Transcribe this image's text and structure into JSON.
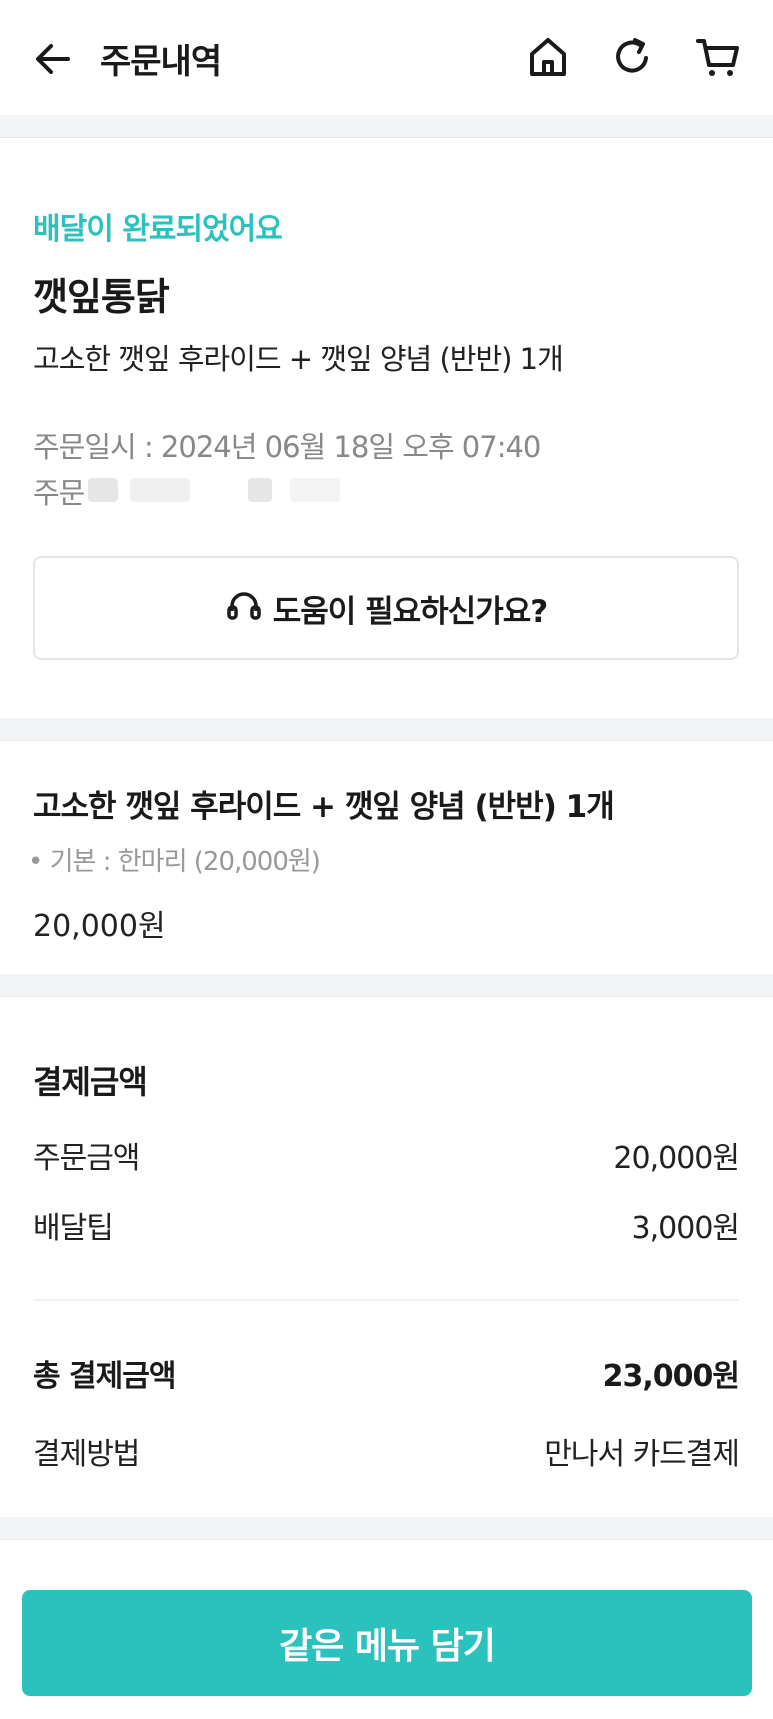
{
  "header": {
    "title": "주문내역",
    "icons": [
      "back-arrow-icon",
      "home-icon",
      "refresh-icon",
      "cart-icon"
    ]
  },
  "order": {
    "status": "배달이 완료되었어요",
    "store_name": "깻잎통닭",
    "menu_summary": "고소한 깻잎 후라이드 + 깻잎 양념 (반반) 1개",
    "order_date": "주문일시 : 2024년 06월 18일 오후 07:40",
    "order_number_label": "주문",
    "help_button": "도움이 필요하신가요?"
  },
  "item": {
    "name": "고소한 깻잎 후라이드 + 깻잎 양념 (반반) 1개",
    "option": "• 기본 : 한마리 (20,000원)",
    "price": "20,000원"
  },
  "payment": {
    "title": "결제금액",
    "rows": [
      {
        "label": "주문금액",
        "value": "20,000원"
      },
      {
        "label": "배달팁",
        "value": "3,000원"
      }
    ],
    "total": {
      "label": "총 결제금액",
      "value": "23,000원"
    },
    "method": {
      "label": "결제방법",
      "value": "만나서 카드결제"
    }
  },
  "cta": {
    "label": "같은 메뉴 담기"
  },
  "colors": {
    "accent": "#2bc1bc",
    "separator": "#f2f4f6"
  }
}
